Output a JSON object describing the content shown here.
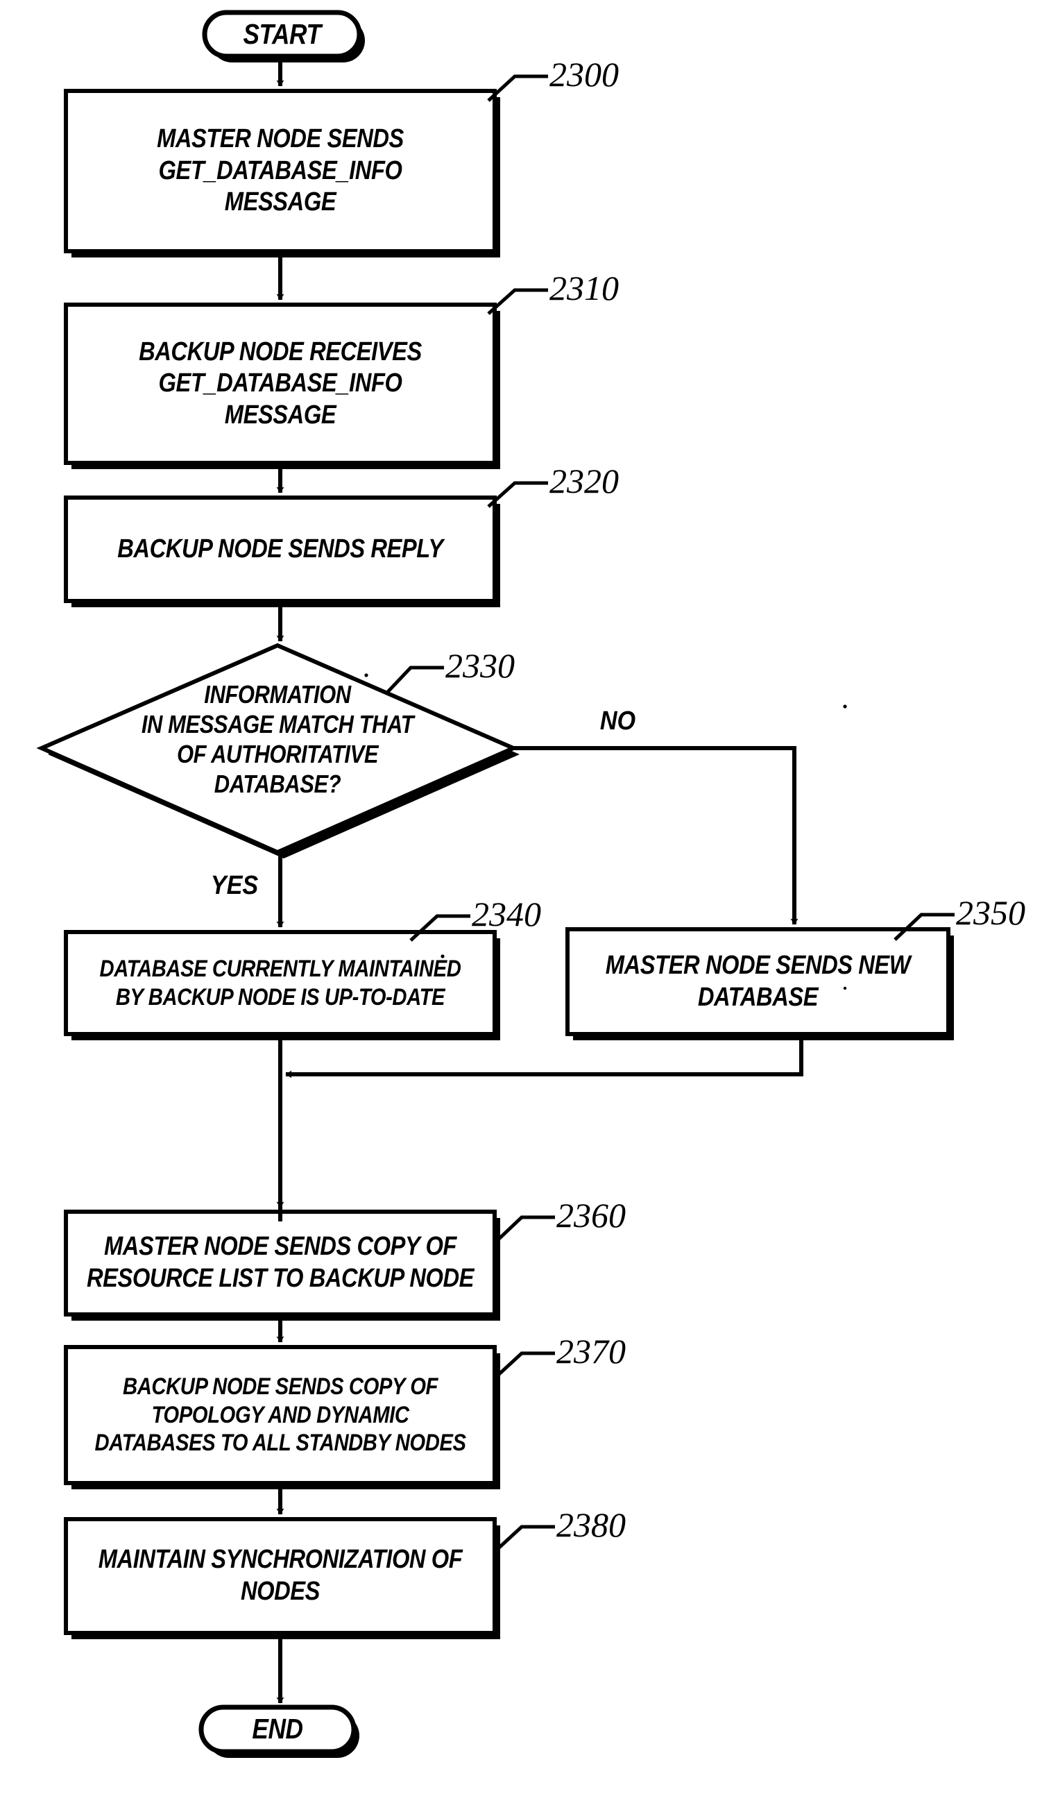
{
  "figure": {
    "title": "Database synchronization flowchart",
    "stroke_color": "#000000",
    "fill_color": "#ffffff",
    "shadow_color": "#000000"
  },
  "nodes": {
    "start": {
      "label": "START",
      "shape": "terminal"
    },
    "end": {
      "label": "END",
      "shape": "terminal"
    },
    "n2300": {
      "ref": "2300",
      "shape": "process",
      "lines": [
        "MASTER NODE SENDS",
        "GET_DATABASE_INFO",
        "MESSAGE"
      ]
    },
    "n2310": {
      "ref": "2310",
      "shape": "process",
      "lines": [
        "BACKUP NODE RECEIVES",
        "GET_DATABASE_INFO",
        "MESSAGE"
      ]
    },
    "n2320": {
      "ref": "2320",
      "shape": "process",
      "lines": [
        "BACKUP NODE SENDS REPLY"
      ]
    },
    "n2330": {
      "ref": "2330",
      "shape": "decision",
      "lines": [
        "INFORMATION",
        "IN MESSAGE MATCH THAT",
        "OF AUTHORITATIVE",
        "DATABASE?"
      ]
    },
    "n2340": {
      "ref": "2340",
      "shape": "process",
      "lines": [
        "DATABASE CURRENTLY MAINTAINED",
        "BY BACKUP NODE IS UP-TO-DATE"
      ]
    },
    "n2350": {
      "ref": "2350",
      "shape": "process",
      "lines": [
        "MASTER NODE SENDS NEW",
        "DATABASE"
      ]
    },
    "n2360": {
      "ref": "2360",
      "shape": "process",
      "lines": [
        "MASTER NODE SENDS COPY OF",
        "RESOURCE LIST TO BACKUP NODE"
      ]
    },
    "n2370": {
      "ref": "2370",
      "shape": "process",
      "lines": [
        "BACKUP NODE SENDS COPY OF",
        "TOPOLOGY AND DYNAMIC",
        "DATABASES TO ALL STANDBY NODES"
      ]
    },
    "n2380": {
      "ref": "2380",
      "shape": "process",
      "lines": [
        "MAINTAIN SYNCHRONIZATION OF",
        "NODES"
      ]
    }
  },
  "branches": {
    "yes": "YES",
    "no": "NO"
  }
}
